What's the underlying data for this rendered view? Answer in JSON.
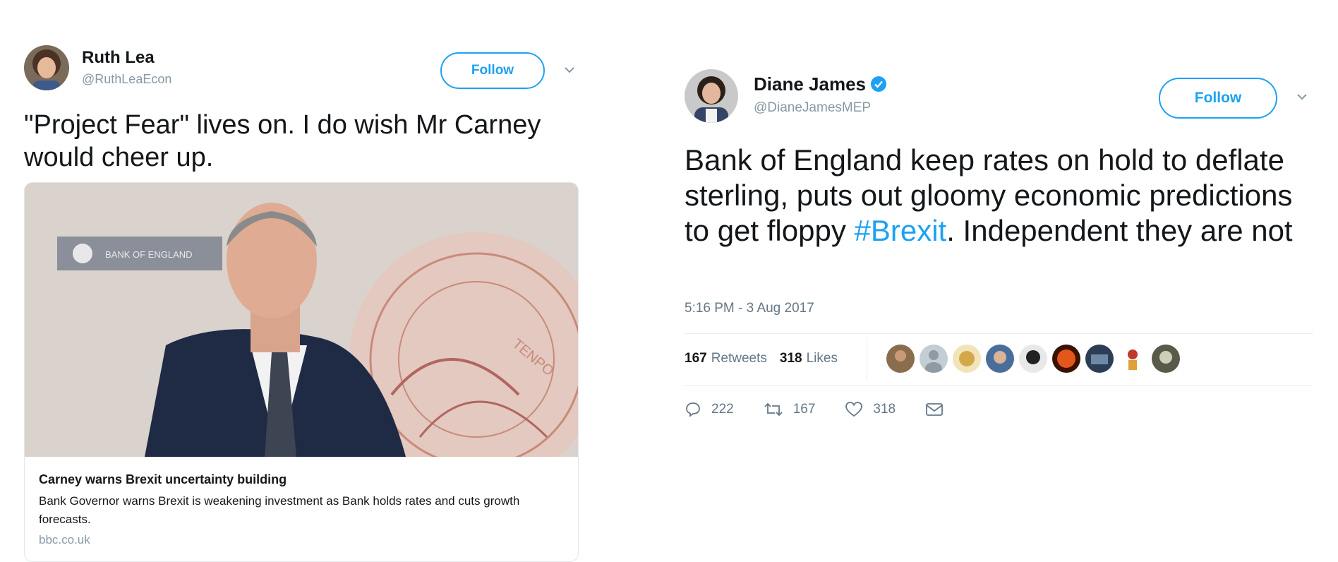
{
  "tweets": [
    {
      "author": {
        "name": "Ruth Lea",
        "handle": "@RuthLeaEcon"
      },
      "follow_label": "Follow",
      "text": "\"Project Fear\" lives on. I do wish Mr Carney would cheer up.",
      "card": {
        "image_sign_text": "BANK OF ENGLAND",
        "image_watermark_text": "TENPO",
        "title": "Carney warns Brexit uncertainty building",
        "description": "Bank Governor warns Brexit is weakening investment as Bank holds rates and cuts growth forecasts.",
        "domain": "bbc.co.uk"
      }
    },
    {
      "author": {
        "name": "Diane James",
        "handle": "@DianeJamesMEP",
        "verified": true
      },
      "follow_label": "Follow",
      "text_before": "Bank of England keep rates on hold to deflate sterling, puts out gloomy economic predictions to get floppy ",
      "hashtag": "#Brexit",
      "text_after": ". Independent they are not",
      "timestamp": "5:16 PM - 3 Aug 2017",
      "stats": {
        "retweets_count": "167",
        "retweets_label": "Retweets",
        "likes_count": "318",
        "likes_label": "Likes"
      },
      "likers_count": 9,
      "actions": {
        "replies": "222",
        "retweets": "167",
        "likes": "318"
      }
    }
  ],
  "colors": {
    "accent": "#1da1f2",
    "secondary_text": "#657786",
    "primary_text": "#14171a"
  }
}
